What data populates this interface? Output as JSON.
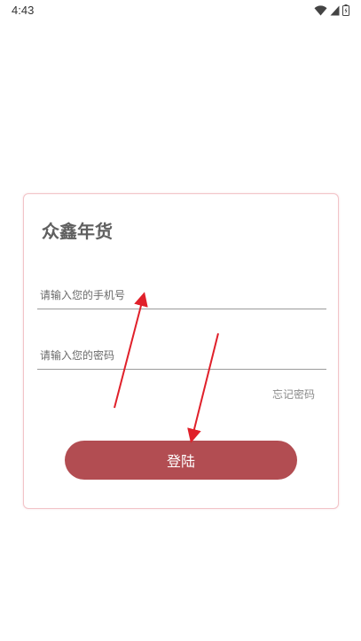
{
  "status_bar": {
    "time": "4:43",
    "icons": [
      "wifi-icon",
      "signal-icon",
      "battery-icon"
    ]
  },
  "login_card": {
    "app_title": "众鑫年货",
    "phone_placeholder": "请输入您的手机号",
    "password_placeholder": "请输入您的密码",
    "forgot_password_label": "忘记密码",
    "login_button_label": "登陆"
  },
  "colors": {
    "accent": "#b24d52",
    "card_border": "#f2c4c8",
    "annotation_arrow": "#e0202a"
  }
}
